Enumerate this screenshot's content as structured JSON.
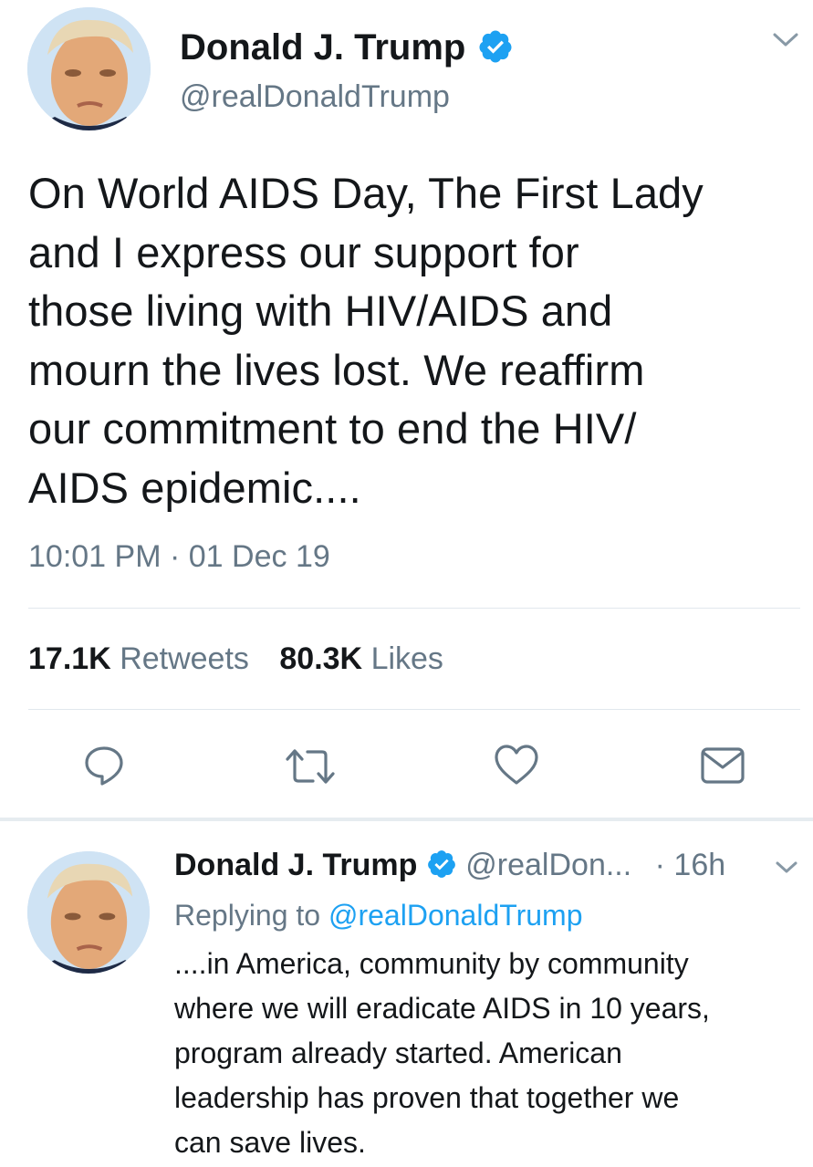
{
  "main_tweet": {
    "author_name": "Donald J. Trump",
    "handle": "@realDonaldTrump",
    "avatar_icon": "profile-photo",
    "verified_icon": "verified-badge-icon",
    "text": "On World AIDS Day, The First Lady\nand I express our support for\nthose living with HIV/AIDS and\nmourn the lives lost. We reaffirm\nour commitment to end the HIV/\nAIDS epidemic....",
    "time": "10:01 PM",
    "separator": "·",
    "date": "01 Dec 19",
    "retweets_count": "17.1K",
    "retweets_label": "Retweets",
    "likes_count": "80.3K",
    "likes_label": "Likes",
    "actions": [
      "reply-icon",
      "retweet-icon",
      "like-icon",
      "direct-message-icon"
    ]
  },
  "reply_tweet": {
    "author_name": "Donald J. Trump",
    "handle_truncated": "@realDon...",
    "time_sep": "·",
    "age": "16h",
    "replying_label": "Replying to",
    "replying_handle": "@realDonaldTrump",
    "text": "....in America, community by community\nwhere we will eradicate AIDS in 10 years,\nprogram already started. American\nleadership has proven that together we\ncan save lives."
  },
  "colors": {
    "accent": "#1da1f2",
    "text": "#14171a",
    "secondary": "#657786",
    "divider": "#e1e8ed"
  }
}
